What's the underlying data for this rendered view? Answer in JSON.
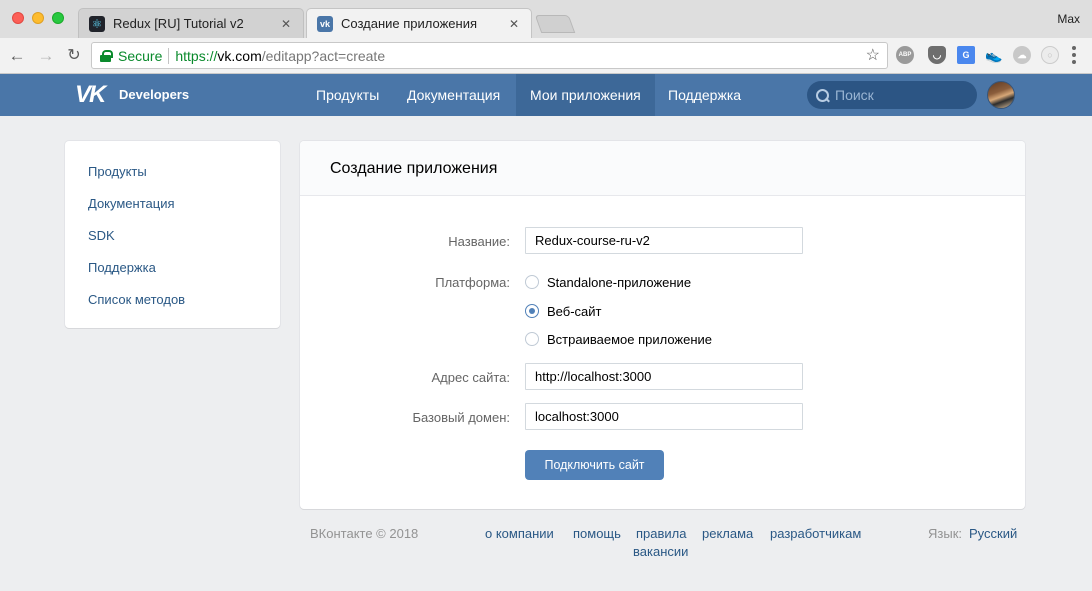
{
  "browser": {
    "tabs": [
      {
        "title": "Redux [RU] Tutorial v2",
        "icon": "react-favicon",
        "active": false
      },
      {
        "title": "Создание приложения",
        "icon": "vk-favicon",
        "active": true
      }
    ],
    "tab_close": "✕",
    "profile_name": "Max",
    "address": {
      "secure_label": "Secure",
      "url_scheme": "https://",
      "url_host": "vk.com",
      "url_path": "/editapp?act=create"
    },
    "nav_icons": {
      "back": "←",
      "forward": "→",
      "reload": "↻",
      "star": "☆"
    },
    "extensions": {
      "abp": "ABP",
      "pocket": "◡",
      "translate": "G",
      "shoe": "👟",
      "cloud": "☁",
      "round": "○"
    }
  },
  "vk": {
    "logo": "VK",
    "brand": "Developers",
    "nav": [
      "Продукты",
      "Документация",
      "Мои приложения",
      "Поддержка"
    ],
    "active_nav_index": 2,
    "search_placeholder": "Поиск"
  },
  "sidebar": {
    "items": [
      "Продукты",
      "Документация",
      "SDK",
      "Поддержка",
      "Список методов"
    ]
  },
  "form": {
    "title": "Создание приложения",
    "name_label": "Название:",
    "name_value": "Redux-course-ru-v2",
    "platform_label": "Платформа:",
    "platforms": [
      {
        "label": "Standalone-приложение",
        "selected": false
      },
      {
        "label": "Веб-сайт",
        "selected": true
      },
      {
        "label": "Встраиваемое приложение",
        "selected": false
      }
    ],
    "site_address_label": "Адрес сайта:",
    "site_address_value": "http://localhost:3000",
    "base_domain_label": "Базовый домен:",
    "base_domain_value": "localhost:3000",
    "submit_label": "Подключить сайт"
  },
  "footer": {
    "copyright": "ВКонтакте © 2018",
    "links": [
      "о компании",
      "помощь",
      "правила",
      "реклама",
      "разработчикам",
      "вакансии"
    ],
    "language_label": "Язык:",
    "language_value": "Русский"
  },
  "colors": {
    "vk_blue": "#4a76a8",
    "vk_active_nav": "#3d6898",
    "link_blue": "#2a5885",
    "button_blue": "#5181b8",
    "secure_green": "#0a8a2c",
    "page_bg": "#edeef0"
  }
}
